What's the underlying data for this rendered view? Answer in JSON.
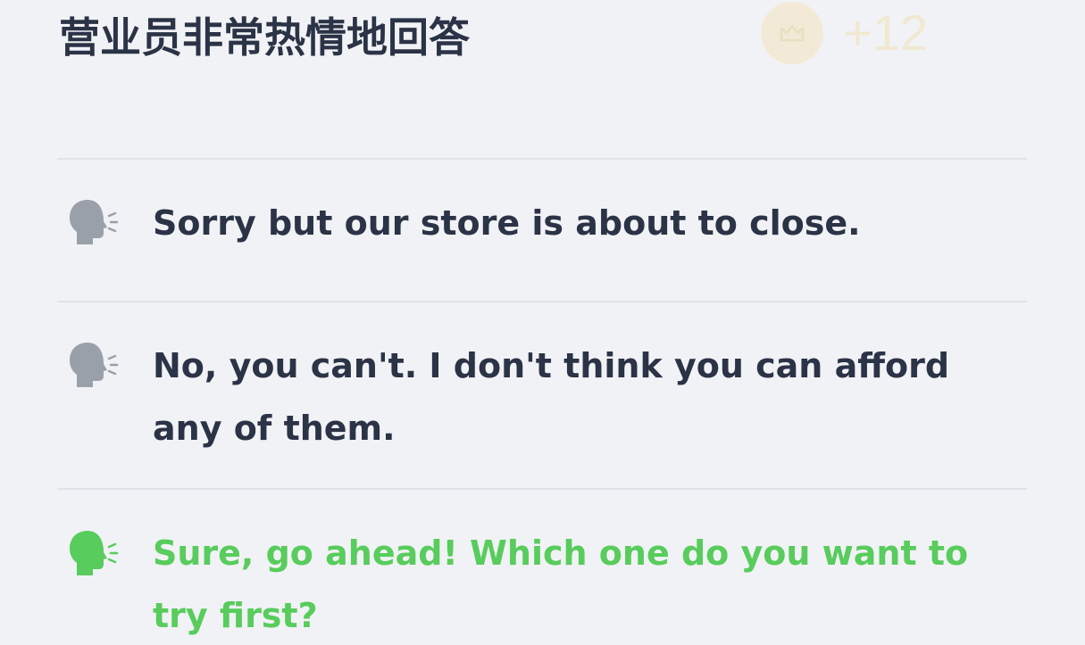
{
  "question": {
    "title": "营业员非常热情地回答",
    "reward": {
      "points": "+12",
      "icon": "crown-coin-icon",
      "color": "#f2cf76"
    }
  },
  "options": [
    {
      "text": "Sorry but our store is about to close.",
      "icon": "speaking-head-icon",
      "state": "default",
      "icon_color": "#9aa0aa"
    },
    {
      "text": "No, you can't. I don't think you can afford any of them.",
      "icon": "speaking-head-icon",
      "state": "default",
      "icon_color": "#9aa0aa"
    },
    {
      "text": "Sure, go ahead! Which one do you want to try first?",
      "icon": "speaking-head-icon",
      "state": "correct",
      "icon_color": "#58cc5c"
    }
  ],
  "colors": {
    "background": "#f1f2f5",
    "text": "#2b3346",
    "correct": "#58cc5c",
    "divider": "#e0e2e7"
  }
}
